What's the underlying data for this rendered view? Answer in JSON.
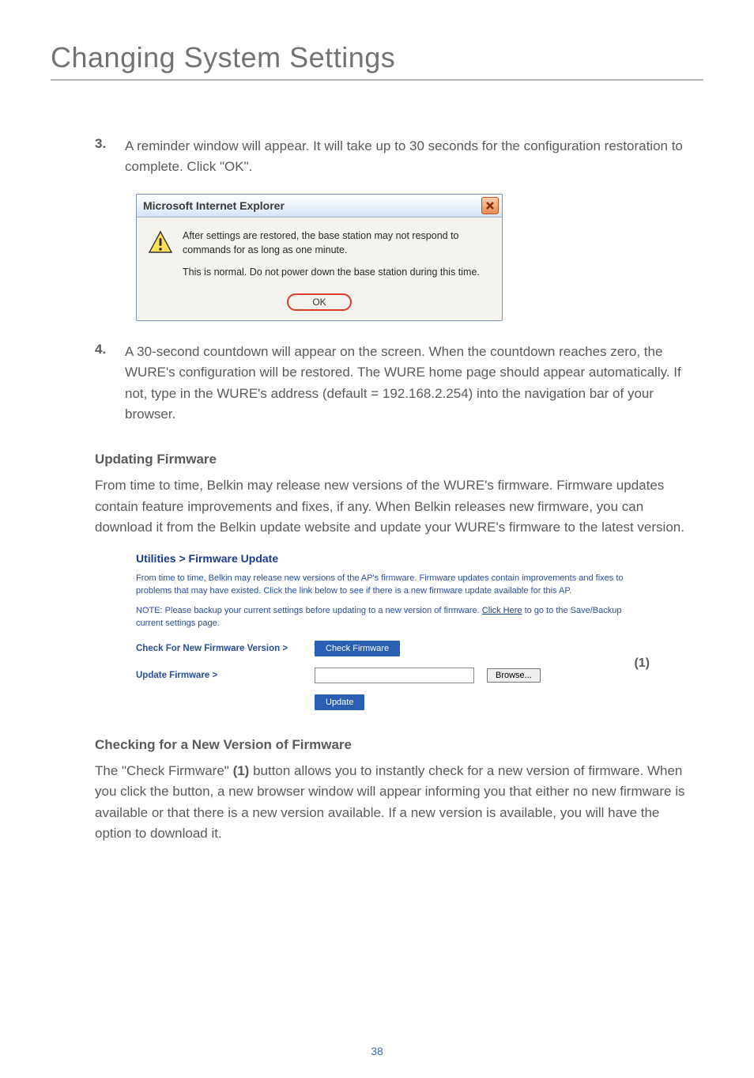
{
  "title": "Changing System Settings",
  "step3": {
    "num": "3.",
    "text": "A reminder window will appear. It will take up to 30 seconds for the configuration restoration to complete. Click \"OK\"."
  },
  "dialog": {
    "title": "Microsoft Internet Explorer",
    "line1": "After settings are restored, the base station may not respond to commands for as long as one minute.",
    "line2": "This is normal. Do not power down the base station during this time.",
    "ok": "OK"
  },
  "step4": {
    "num": "4.",
    "text": "A 30-second countdown will appear on the screen. When the countdown reaches zero, the WURE's configuration will be restored. The WURE home page should appear automatically. If not, type in the WURE's address (default = 192.168.2.254) into the navigation bar of your browser."
  },
  "updating": {
    "heading": "Updating Firmware",
    "para": "From time to time, Belkin may release new versions of the WURE's firmware. Firmware updates contain feature improvements and fixes, if any. When Belkin releases new firmware, you can download it from the Belkin update website and update your WURE's firmware to the latest version."
  },
  "fw": {
    "breadcrumb": "Utilities > Firmware Update",
    "desc1": "From time to time, Belkin may release new versions of the AP's firmware. Firmware updates contain improvements and fixes to problems that may have existed. Click the link below to see if there is a new firmware update available for this AP.",
    "desc2_a": "NOTE: Please backup your current settings before updating to a new version of firmware. ",
    "desc2_link": "Click Here",
    "desc2_b": " to go to the Save/Backup current settings page.",
    "check_label": "Check For New Firmware Version >",
    "check_btn": "Check Firmware",
    "update_label": "Update Firmware >",
    "browse": "Browse...",
    "update_btn": "Update",
    "annot": "(1)"
  },
  "checking": {
    "heading": "Checking for a New Version of Firmware",
    "para_a": "The \"Check Firmware\" ",
    "para_bold": "(1)",
    "para_b": " button allows you to instantly check for a new version of firmware. When you click the button, a new browser window will appear informing you that either no new firmware is available or that there is a new version available. If a new version is available, you will have the option to download it."
  },
  "pagenum": "38"
}
